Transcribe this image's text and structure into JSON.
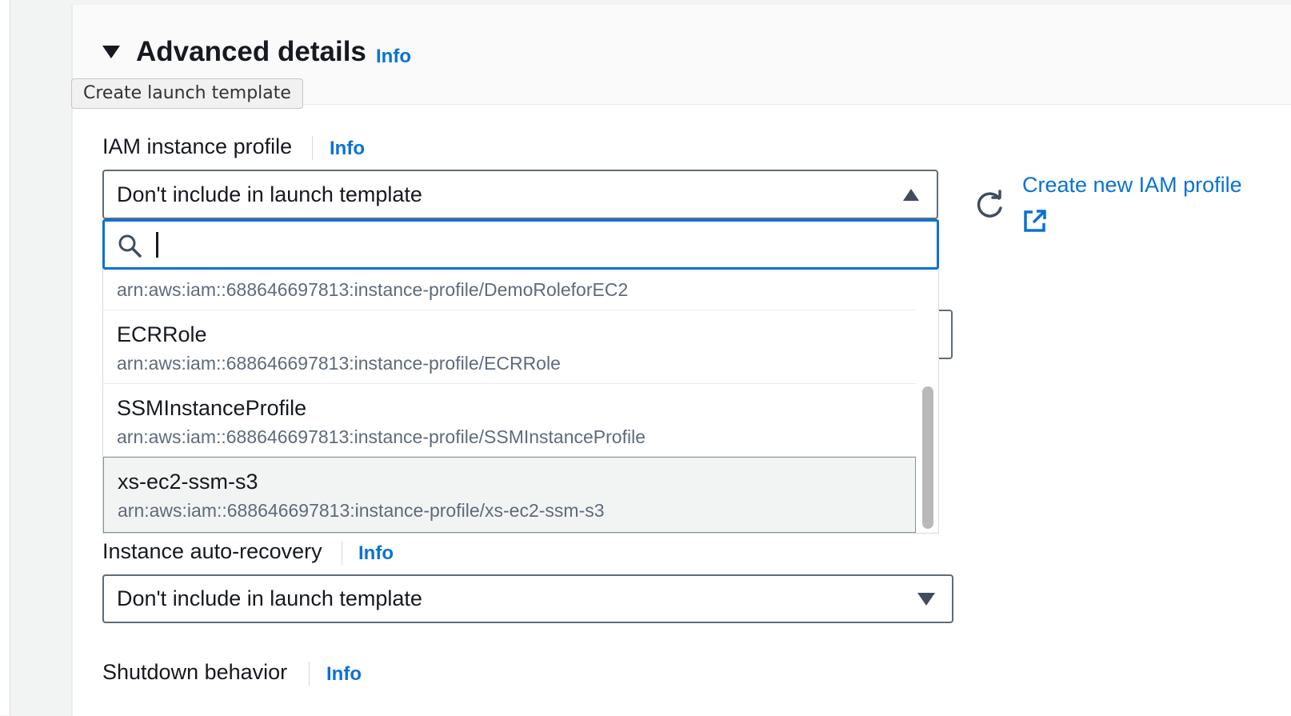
{
  "advanced": {
    "title": "Advanced details",
    "info": "Info",
    "tooltip": "Create launch template"
  },
  "iam": {
    "label": "IAM instance profile",
    "info": "Info",
    "selected": "Don't include in launch template",
    "search_value": "",
    "refresh_icon": "refresh-icon",
    "create_link": "Create new IAM profile",
    "external_icon": "external-link-icon",
    "options": [
      {
        "name": "",
        "arn": "arn:aws:iam::688646697813:instance-profile/DemoRoleforEC2"
      },
      {
        "name": "ECRRole",
        "arn": "arn:aws:iam::688646697813:instance-profile/ECRRole"
      },
      {
        "name": "SSMInstanceProfile",
        "arn": "arn:aws:iam::688646697813:instance-profile/SSMInstanceProfile"
      },
      {
        "name": "xs-ec2-ssm-s3",
        "arn": "arn:aws:iam::688646697813:instance-profile/xs-ec2-ssm-s3"
      }
    ]
  },
  "auto_recovery": {
    "label": "Instance auto-recovery",
    "info": "Info",
    "selected": "Don't include in launch template"
  },
  "shutdown": {
    "label": "Shutdown behavior",
    "info": "Info"
  },
  "colors": {
    "link": "#0972d3",
    "focus": "#0972d3",
    "text": "#16191f",
    "subtext": "#5f6b7a"
  }
}
